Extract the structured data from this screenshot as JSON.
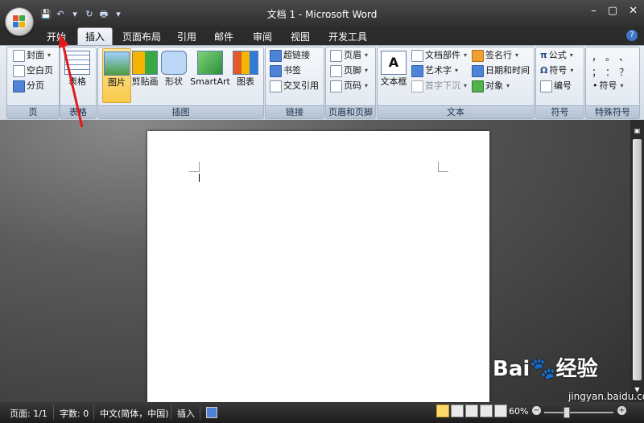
{
  "app": {
    "title": "文档 1 - Microsoft Word",
    "window_controls": {
      "minimize": "–",
      "maximize": "▢",
      "close": "✕"
    },
    "help": "?"
  },
  "qat": {
    "save": "💾",
    "undo": "↶",
    "undo_dd": "▾",
    "redo": "↻",
    "print": "🖶",
    "customize": "▾"
  },
  "tabs": [
    "开始",
    "插入",
    "页面布局",
    "引用",
    "邮件",
    "审阅",
    "视图",
    "开发工具"
  ],
  "active_tab": "插入",
  "ribbon": {
    "pages": {
      "label": "页",
      "cover": "封面",
      "blank": "空白页",
      "break": "分页"
    },
    "tables": {
      "label": "表格",
      "table": "表格"
    },
    "illustrations": {
      "label": "插图",
      "picture": "图片",
      "clipart": "剪贴画",
      "shapes": "形状",
      "smartart": "SmartArt",
      "chart": "图表"
    },
    "links": {
      "label": "链接",
      "hyperlink": "超链接",
      "bookmark": "书签",
      "crossref": "交叉引用"
    },
    "header_footer": {
      "label": "页眉和页脚",
      "header": "页眉",
      "footer": "页脚",
      "pagenum": "页码"
    },
    "text": {
      "label": "文本",
      "textbox": "文本框",
      "quickparts": "文档部件",
      "wordart": "艺术字",
      "dropcap": "首字下沉",
      "signature": "签名行",
      "datetime": "日期和时间",
      "object": "对象"
    },
    "symbols": {
      "label": "符号",
      "equation": "公式",
      "symbol": "符号",
      "number": "编号"
    },
    "special": {
      "label": "特殊符号",
      "row1": [
        "，",
        "。",
        "、"
      ],
      "row2": [
        "；",
        "：",
        "？"
      ],
      "symbol": "符号"
    }
  },
  "statusbar": {
    "page": "页面: 1/1",
    "words": "字数: 0",
    "language": "中文(简体，中国)",
    "mode": "插入",
    "zoom": "60%",
    "zoom_minus": "−",
    "zoom_plus": "+"
  },
  "watermark": {
    "brand": "Bai🐾经验",
    "url": "jingyan.baidu.com"
  },
  "colors": {
    "accent": "#f8c94a",
    "annotation": "#e01b1b"
  }
}
